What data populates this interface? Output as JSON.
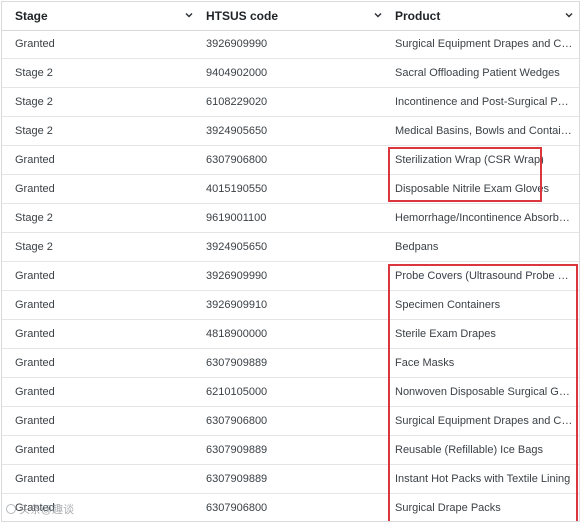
{
  "table": {
    "headers": [
      "Stage",
      "HTSUS code",
      "Product"
    ],
    "rows": [
      {
        "stage": "Granted",
        "code": "3926909990",
        "product": "Surgical Equipment Drapes and Covers"
      },
      {
        "stage": "Stage 2",
        "code": "9404902000",
        "product": "Sacral Offloading Patient Wedges"
      },
      {
        "stage": "Stage 2",
        "code": "6108229020",
        "product": "Incontinence and Post-Surgical Pants"
      },
      {
        "stage": "Stage 2",
        "code": "3924905650",
        "product": "Medical Basins, Bowls and Containers"
      },
      {
        "stage": "Granted",
        "code": "6307906800",
        "product": "Sterilization Wrap (CSR Wrap)"
      },
      {
        "stage": "Granted",
        "code": "4015190550",
        "product": "Disposable Nitrile Exam Gloves"
      },
      {
        "stage": "Stage 2",
        "code": "9619001100",
        "product": "Hemorrhage/Incontinence Absorbent ..."
      },
      {
        "stage": "Stage 2",
        "code": "3924905650",
        "product": "Bedpans"
      },
      {
        "stage": "Granted",
        "code": "3926909990",
        "product": "Probe Covers (Ultrasound Probe Covers)"
      },
      {
        "stage": "Granted",
        "code": "3926909910",
        "product": "Specimen Containers"
      },
      {
        "stage": "Granted",
        "code": "4818900000",
        "product": "Sterile Exam Drapes"
      },
      {
        "stage": "Granted",
        "code": "6307909889",
        "product": "Face Masks"
      },
      {
        "stage": "Granted",
        "code": "6210105000",
        "product": "Nonwoven Disposable Surgical Gowns"
      },
      {
        "stage": "Granted",
        "code": "6307906800",
        "product": "Surgical Equipment Drapes and Covers"
      },
      {
        "stage": "Granted",
        "code": "6307909889",
        "product": "Reusable (Refillable) Ice Bags"
      },
      {
        "stage": "Granted",
        "code": "6307909889",
        "product": "Instant Hot Packs with Textile Lining"
      },
      {
        "stage": "Granted",
        "code": "6307906800",
        "product": "Surgical Drape Packs"
      }
    ]
  },
  "watermark": {
    "text": "头条@趣谈"
  },
  "colors": {
    "highlight": "#d9363e",
    "header_text": "#1f2326",
    "cell_text": "#3b4146",
    "divider": "#e3e5e7"
  },
  "icons": {
    "sort": "chevron-down-icon",
    "watermark": "watermark-logo-icon"
  }
}
